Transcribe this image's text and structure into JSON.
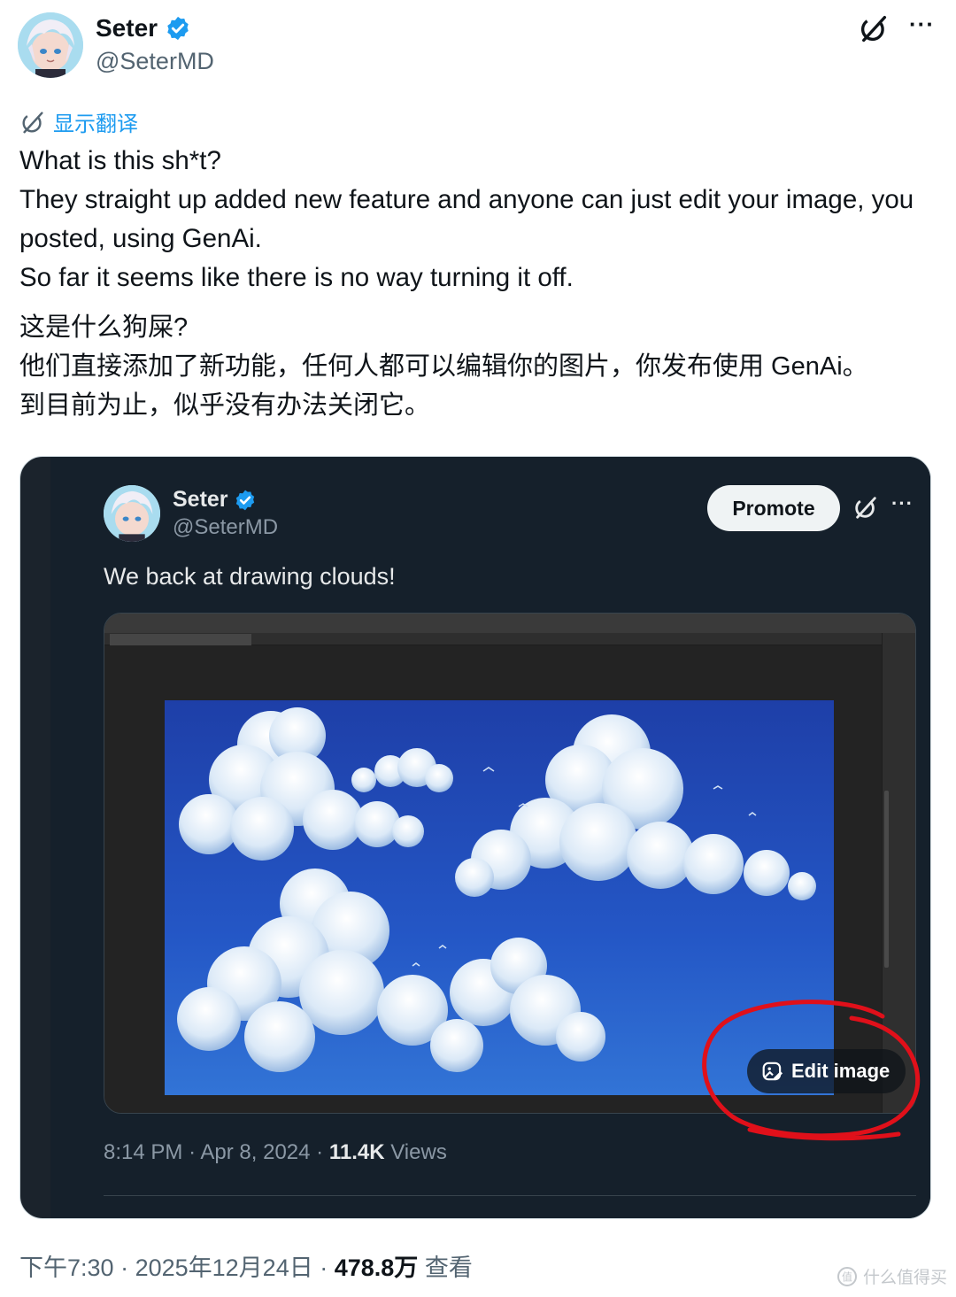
{
  "tweet": {
    "author": {
      "display_name": "Seter",
      "handle": "@SeterMD"
    },
    "translate_label": "显示翻译",
    "text_en": "What is this sh*t?\nThey straight up added new feature and anyone can just edit your image, you posted, using GenAi.\nSo far it seems like there is no way turning it off.",
    "text_zh": "这是什么狗屎?\n他们直接添加了新功能，任何人都可以编辑你的图片，你发布使用 GenAi。\n到目前为止，似乎没有办法关闭它。",
    "meta": {
      "time": "下午7:30",
      "date": "2025年12月24日",
      "views_count": "478.8万",
      "views_label": "查看"
    }
  },
  "embedded": {
    "author": {
      "display_name": "Seter",
      "handle": "@SeterMD"
    },
    "promote_label": "Promote",
    "text": "We back at drawing clouds!",
    "edit_image_label": "Edit image",
    "meta": {
      "time": "8:14 PM",
      "date": "Apr 8, 2024",
      "views_count": "11.4K",
      "views_label": "Views"
    }
  },
  "watermark": {
    "text": "什么值得买"
  },
  "icons": {
    "verified": "verified-badge-icon",
    "grok": "grok-icon",
    "more": "more-icon",
    "translate": "translate-icon",
    "edit_image": "edit-image-icon"
  },
  "colors": {
    "accent": "#1d9bf0",
    "dark_bg": "#15202b",
    "annotation_red": "#e0101a"
  }
}
